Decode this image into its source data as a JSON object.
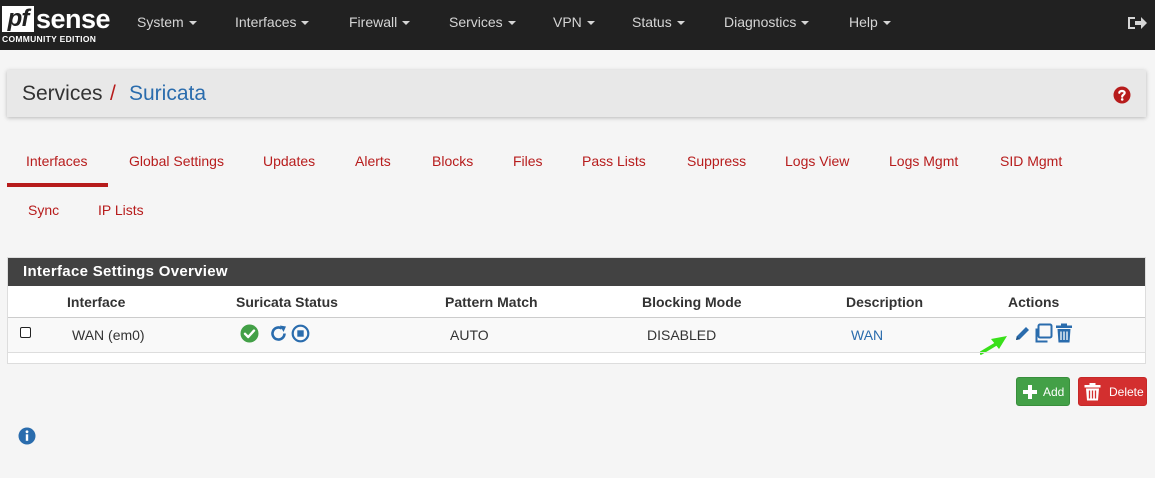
{
  "brand": {
    "name_pf": "pf",
    "name_sense": "sense",
    "edition": "COMMUNITY EDITION"
  },
  "nav": {
    "items": [
      {
        "label": "System"
      },
      {
        "label": "Interfaces"
      },
      {
        "label": "Firewall"
      },
      {
        "label": "Services"
      },
      {
        "label": "VPN"
      },
      {
        "label": "Status"
      },
      {
        "label": "Diagnostics"
      },
      {
        "label": "Help"
      }
    ],
    "logout_icon": "sign-out-icon"
  },
  "breadcrumb": {
    "section": "Services",
    "separator": "/",
    "page": "Suricata",
    "help_icon": "question-circle-icon"
  },
  "tabs": [
    {
      "label": "Interfaces",
      "active": true
    },
    {
      "label": "Global Settings"
    },
    {
      "label": "Updates"
    },
    {
      "label": "Alerts"
    },
    {
      "label": "Blocks"
    },
    {
      "label": "Files"
    },
    {
      "label": "Pass Lists"
    },
    {
      "label": "Suppress"
    },
    {
      "label": "Logs View"
    },
    {
      "label": "Logs Mgmt"
    },
    {
      "label": "SID Mgmt"
    },
    {
      "label": "Sync"
    },
    {
      "label": "IP Lists"
    }
  ],
  "panel": {
    "title": "Interface Settings Overview",
    "columns": [
      "Interface",
      "Suricata Status",
      "Pattern Match",
      "Blocking Mode",
      "Description",
      "Actions"
    ],
    "rows": [
      {
        "interface": "WAN (em0)",
        "status_icons": [
          "check-circle-icon",
          "restart-icon",
          "stop-circle-icon"
        ],
        "pattern_match": "AUTO",
        "blocking_mode": "DISABLED",
        "description": "WAN",
        "actions": [
          "edit-pencil-icon",
          "copy-icon",
          "trash-icon"
        ]
      }
    ]
  },
  "buttons": {
    "add": "Add",
    "delete": "Delete"
  },
  "colors": {
    "navbar": "#212121",
    "accent_red": "#b71c1c",
    "link_blue": "#2a6cad",
    "add_green": "#43a047",
    "delete_red": "#d32f2f",
    "panel_heading": "#424242"
  }
}
